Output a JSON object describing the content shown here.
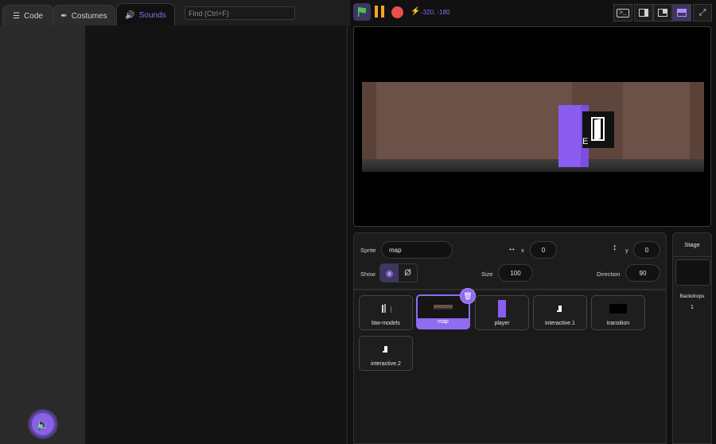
{
  "tabs": [
    {
      "label": "Code",
      "icon": "code-icon"
    },
    {
      "label": "Costumes",
      "icon": "brush-icon"
    },
    {
      "label": "Sounds",
      "icon": "speaker-icon"
    }
  ],
  "find": {
    "placeholder": "Find (Ctrl+F)"
  },
  "controls": {
    "coords": "-320, -180"
  },
  "stage": {
    "interact_key": "E"
  },
  "sprite_info": {
    "sprite_label": "Sprite",
    "sprite_name": "map",
    "x_label": "x",
    "x_value": "0",
    "y_label": "y",
    "y_value": "0",
    "show_label": "Show",
    "size_label": "Size",
    "size_value": "100",
    "direction_label": "Direction",
    "direction_value": "90"
  },
  "sprites": [
    {
      "name": "btw-models",
      "selected": false
    },
    {
      "name": "map",
      "selected": true
    },
    {
      "name": "player",
      "selected": false
    },
    {
      "name": "interactive.1",
      "selected": false
    },
    {
      "name": "transition",
      "selected": false
    },
    {
      "name": "interactive.2",
      "selected": false
    }
  ],
  "stage_pane": {
    "title": "Stage",
    "backdrops_label": "Backdrops",
    "backdrops_count": "1"
  },
  "colors": {
    "accent": "#8f6cf0",
    "flag": "#4cbf56",
    "pause": "#f5a623",
    "stop": "#ec4d4d"
  }
}
